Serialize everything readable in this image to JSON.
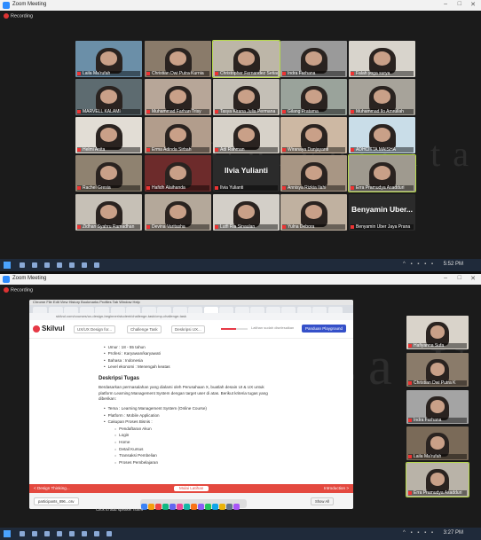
{
  "top": {
    "title": "Zoom Meeting",
    "recording": "Recording",
    "time": "5:52 PM",
    "watermark": "Universita",
    "tiles": [
      {
        "name": "Laila Ma'rufah",
        "bg": "#6b8fa8"
      },
      {
        "name": "Christian Dwi Putra Kurnia",
        "bg": "#8a7b6a"
      },
      {
        "name": "Christopher Fernandez Setiawan",
        "bg": "#bdb6a8",
        "hl": true
      },
      {
        "name": "Indra Farhana",
        "bg": "#9a9a9a"
      },
      {
        "name": "Falah yoga surya",
        "bg": "#d8d4cc"
      },
      {
        "name": "MARVELL KALAMI",
        "bg": "#5d6b70"
      },
      {
        "name": "Muhammad Farhan Trisy",
        "bg": "#b7a698"
      },
      {
        "name": "Tasya Kirana Julia Permana",
        "bg": "#c4bfb6"
      },
      {
        "name": "Gilang Pratama",
        "bg": "#9aa39b"
      },
      {
        "name": "Muhammad Ilo Amrullah",
        "bg": "#a7a39a"
      },
      {
        "name": "Helmi Anita",
        "bg": "#e2ddd5"
      },
      {
        "name": "Erma Adinda Sirbah",
        "bg": "#b29d8c"
      },
      {
        "name": "Adi Rahman",
        "bg": "#d7d2c9"
      },
      {
        "name": "Wiranaya Danjayanti",
        "bg": "#cdb8a3"
      },
      {
        "name": "ADHCITTA MAISHA",
        "bg": "#c9dde8"
      },
      {
        "name": "Rachel Gresia",
        "bg": "#8f8270"
      },
      {
        "name": "Hafidh Alaihanda",
        "bg": "#6d2b2b"
      },
      {
        "name": "Ilvia Yulianti",
        "bg": "#2b2b2b",
        "big": "Ilvia Yulianti"
      },
      {
        "name": "Annisya Rizkia Ilahi",
        "bg": "#a89684"
      },
      {
        "name": "Erra Pramudya Asadduri",
        "bg": "#9f9a8f",
        "hl": true
      },
      {
        "name": "Zidhan Syahru Ramadhan",
        "bg": "#c6c0b6"
      },
      {
        "name": "Devina Varitasha",
        "bg": "#b4a89a"
      },
      {
        "name": "Lutfi Ria Sinaulan",
        "bg": "#d3cfc8"
      },
      {
        "name": "Yulna Debora",
        "bg": "#c0b1a0"
      },
      {
        "name": "Benyamin Uber Jaya Prana",
        "bg": "#2b2b2b",
        "big": "Benyamin Uber..."
      }
    ]
  },
  "bottom": {
    "title": "Zoom Meeting",
    "recording": "Recording",
    "time": "3:27 PM",
    "watermark": "Esa U",
    "mac_menu": "Chrome   File   Edit   View   History   Bookmarks   Profiles   Tab   Window   Help",
    "url": "skilvul.com/courses/ux-design-beginner/student/challenge-task/cmp-challenge-task",
    "app": {
      "logo": "Skilvul",
      "crumb1": "UX/UX Design for...",
      "crumb2": "Challenge Task",
      "crumb3": "Deskripsi UX...",
      "progress_label": "Latihan sudah diselesaikan",
      "progress": 0.55,
      "playground_btn": "Panduan Playground",
      "bullets_top": [
        "Umur : 18 - 55 tahun",
        "Profesi : Karyawan/karyawati",
        "Bahasa : Indonesia",
        "Level ekonomi : Menengah keatas"
      ],
      "section_title": "Deskripsi Tugas",
      "paragraph": "Berdasarkan permasalahan yang dialami oleh Perusahaan X, buatlah desain UI & UX untuk platform Learning Management System dengan target user di atas. Berikut kriteria tugas yang diberikan:",
      "bullets_task": [
        "Tema : Learning Management System (Online Course)",
        "Platform : Mobile Application",
        "Cakupan Proses Bisnis :"
      ],
      "sub_items": [
        "Pendaftaran Akun",
        "Login",
        "Home",
        "Detail Kursus",
        "Transaksi Pembelian",
        "Proses Pembelajaran"
      ],
      "prev_btn": "< Design Thinking...",
      "mark_btn": "Mulai Latihan",
      "next_btn": "Introduction >",
      "download": "participants_896...csv",
      "show_all": "Show All",
      "speakers": "Click to add speaker notes"
    },
    "side": [
      {
        "name": "Hafiyanna Sufa",
        "bg": "#d9d3ca"
      },
      {
        "name": "Christian Dwi Putra K",
        "bg": "#8a7b6a"
      },
      {
        "name": "Indra Farhana",
        "bg": "#a4a4a4"
      },
      {
        "name": "Laila Ma'rufah",
        "bg": "#7a6a58"
      },
      {
        "name": "Erra Pramudya Asadduri",
        "bg": "#b9b3a8",
        "hl": true
      }
    ]
  }
}
